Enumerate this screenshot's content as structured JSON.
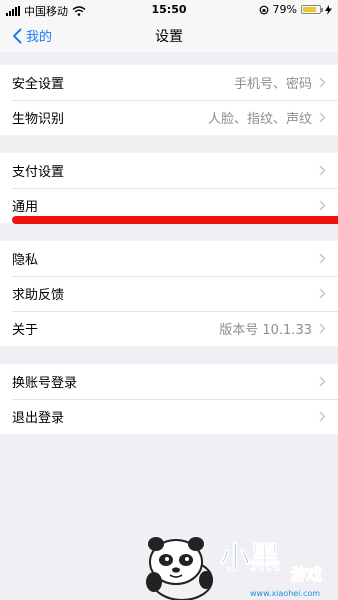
{
  "status_bar": {
    "carrier": "中国移动",
    "time": "15:50",
    "battery_text": "79%",
    "battery_level": 0.79,
    "battery_color": "#f4c430"
  },
  "nav": {
    "back_label": "我的",
    "title": "设置",
    "back_icon": "chevron-left-icon"
  },
  "groups": [
    {
      "rows": [
        {
          "label": "安全设置",
          "detail": "手机号、密码"
        },
        {
          "label": "生物识别",
          "detail": "人脸、指纹、声纹"
        }
      ]
    },
    {
      "rows": [
        {
          "label": "支付设置",
          "detail": ""
        },
        {
          "label": "通用",
          "detail": ""
        }
      ]
    },
    {
      "rows": [
        {
          "label": "隐私",
          "detail": ""
        },
        {
          "label": "求助反馈",
          "detail": ""
        },
        {
          "label": "关于",
          "detail": "版本号 10.1.33"
        }
      ]
    },
    {
      "rows": [
        {
          "label": "换账号登录",
          "detail": ""
        },
        {
          "label": "退出登录",
          "detail": ""
        }
      ]
    }
  ],
  "watermark": {
    "text": "小黑游戏",
    "url_text": "www.xiaohei.com",
    "color": "#1e8fe0"
  },
  "colors": {
    "accent": "#1a7cf5",
    "highlight_line": "#f01010",
    "background": "#efeff4"
  }
}
